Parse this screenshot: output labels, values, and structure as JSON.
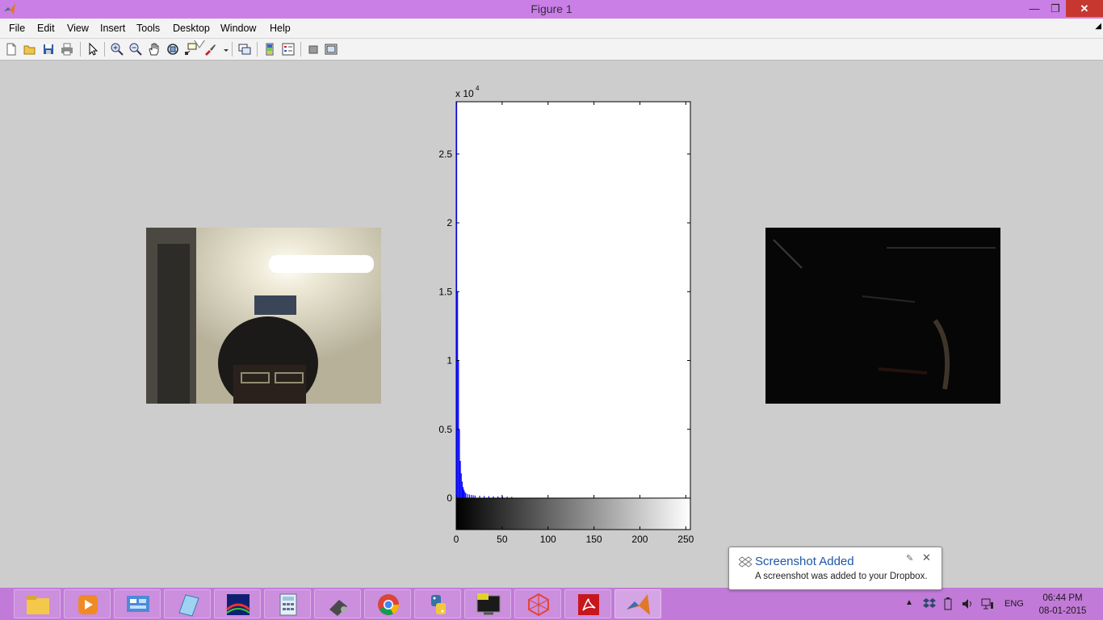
{
  "window": {
    "title": "Figure 1",
    "icon": "matlab-icon"
  },
  "menu": [
    "File",
    "Edit",
    "View",
    "Insert",
    "Tools",
    "Desktop",
    "Window",
    "Help"
  ],
  "toolbar": {
    "icons": [
      "new-figure-icon",
      "open-file-icon",
      "save-icon",
      "print-icon",
      "edit-plot-icon",
      "zoom-in-icon",
      "zoom-out-icon",
      "pan-icon",
      "rotate-3d-icon",
      "data-cursor-icon",
      "brush-icon",
      "link-plot-icon",
      "insert-colorbar-icon",
      "insert-legend-icon",
      "hide-plot-tools-icon",
      "show-plot-tools-icon"
    ]
  },
  "left_image": {
    "name": "webcam-photo",
    "description_icon": "photo-image"
  },
  "right_image": {
    "name": "difference-image"
  },
  "chart_data": {
    "type": "bar",
    "title": "",
    "xlabel": "",
    "ylabel": "",
    "y_multiplier_label": "x 10",
    "y_multiplier_exponent": "4",
    "xlim": [
      0,
      255
    ],
    "ylim": [
      0,
      28800
    ],
    "x_ticks": [
      "0",
      "50",
      "100",
      "150",
      "200",
      "250"
    ],
    "y_ticks": [
      "0",
      "0.5",
      "1",
      "1.5",
      "2",
      "2.5"
    ],
    "color": "#0000ff",
    "colorbar": "grayscale",
    "bins": [
      0,
      1,
      2,
      3,
      4,
      5,
      6,
      7,
      8,
      9,
      10,
      12,
      14,
      16,
      18,
      20,
      25,
      30,
      35,
      40,
      45,
      50,
      55,
      60
    ],
    "values": [
      28800,
      15000,
      10000,
      5000,
      2700,
      1800,
      1200,
      800,
      600,
      450,
      350,
      300,
      260,
      230,
      210,
      190,
      170,
      150,
      140,
      130,
      120,
      110,
      100,
      90
    ]
  },
  "taskbar": {
    "apps": [
      "file-explorer-icon",
      "media-player-icon",
      "control-panel-icon",
      "notepad-icon",
      "visual-studio-icon",
      "calculator-icon",
      "disk-tool-icon",
      "chrome-icon",
      "python-icon",
      "terminal-icon",
      "network-app-icon",
      "acrobat-icon",
      "matlab-icon"
    ]
  },
  "tray": {
    "language": "ENG",
    "time": "06:44 PM",
    "date": "08-01-2015"
  },
  "toast": {
    "title": "Screenshot Added",
    "body": "A screenshot was added to your Dropbox."
  }
}
